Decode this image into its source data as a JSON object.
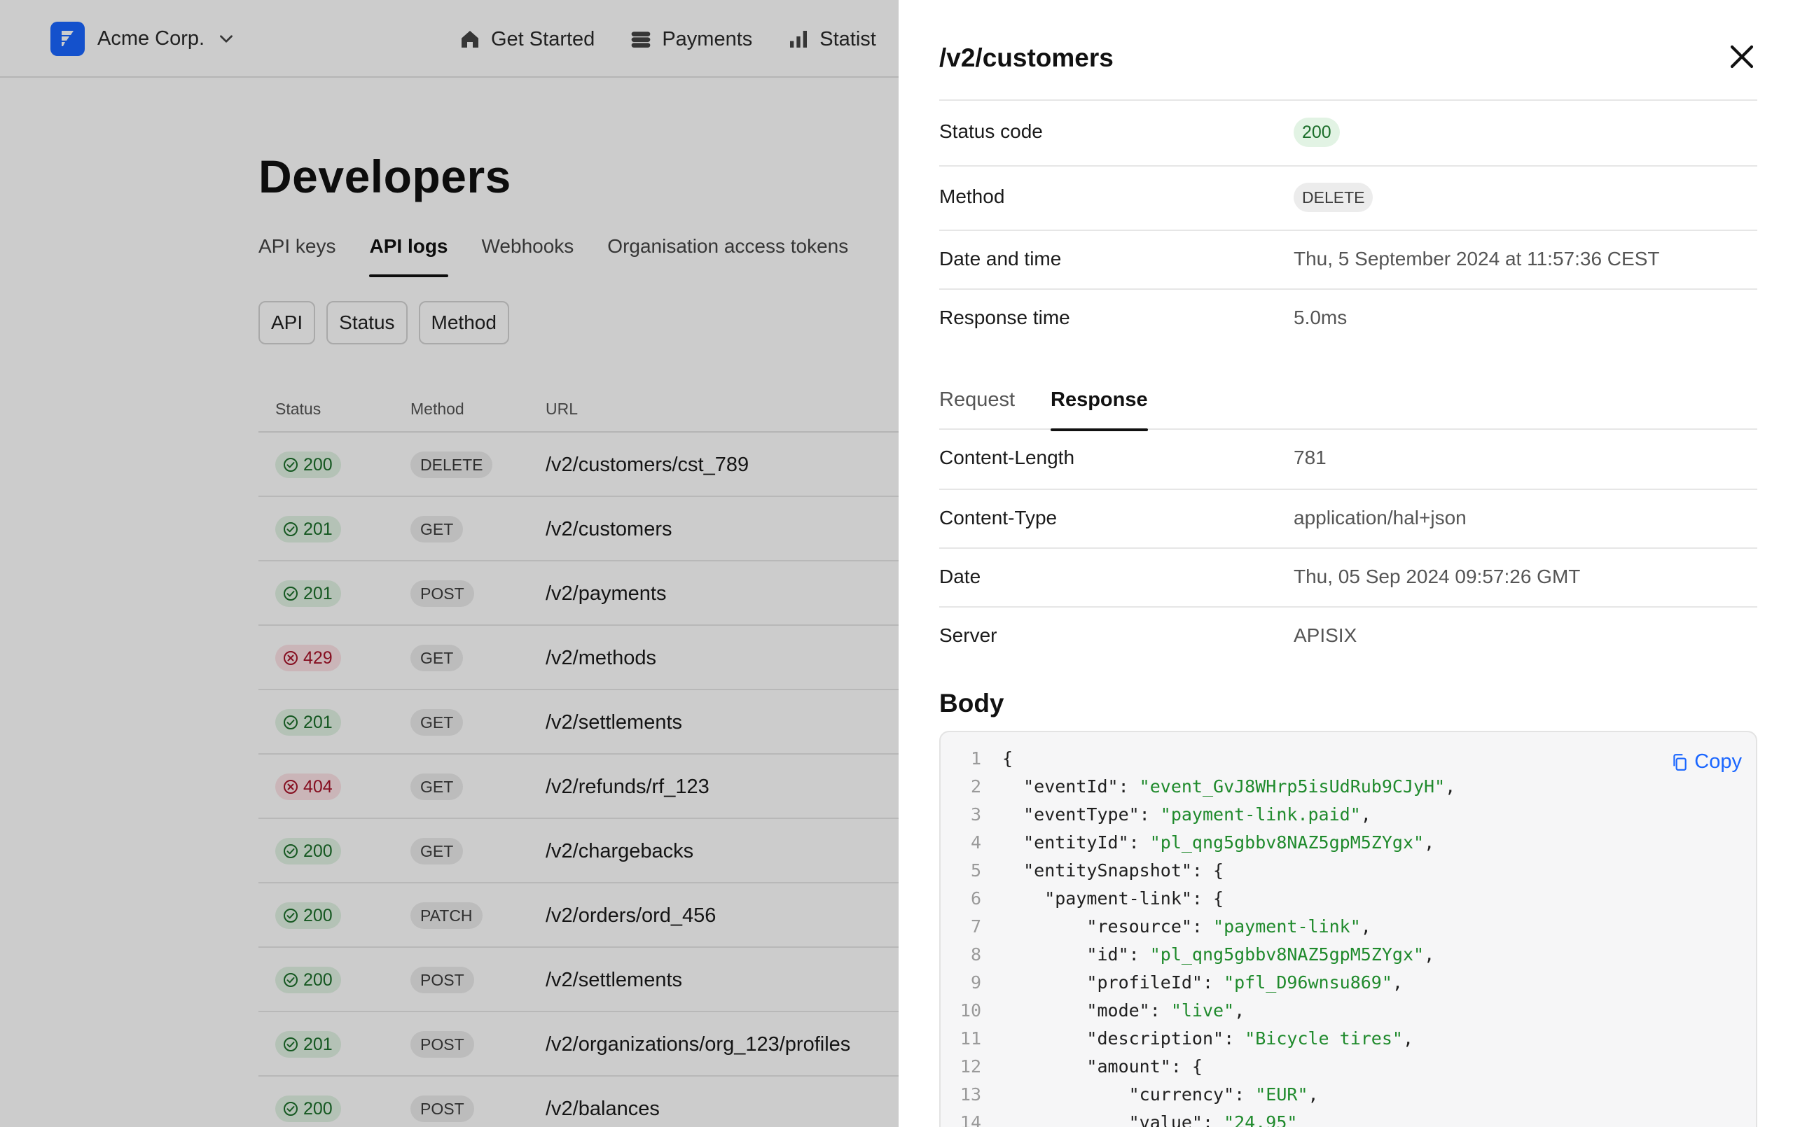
{
  "app": {
    "org_name": "Acme Corp.",
    "nav": [
      {
        "label": "Get Started",
        "icon": "home-icon"
      },
      {
        "label": "Payments",
        "icon": "payments-icon"
      },
      {
        "label": "Statist",
        "icon": "statistics-icon"
      }
    ],
    "page_title": "Developers",
    "tabs": [
      {
        "label": "API keys",
        "active": false
      },
      {
        "label": "API logs",
        "active": true
      },
      {
        "label": "Webhooks",
        "active": false
      },
      {
        "label": "Organisation access tokens",
        "active": false
      }
    ],
    "filters": [
      "API",
      "Status",
      "Method"
    ],
    "table": {
      "headers": {
        "status": "Status",
        "method": "Method",
        "url": "URL"
      },
      "rows": [
        {
          "status": "200",
          "ok": true,
          "method": "DELETE",
          "url": "/v2/customers/cst_789"
        },
        {
          "status": "201",
          "ok": true,
          "method": "GET",
          "url": "/v2/customers"
        },
        {
          "status": "201",
          "ok": true,
          "method": "POST",
          "url": "/v2/payments"
        },
        {
          "status": "429",
          "ok": false,
          "method": "GET",
          "url": "/v2/methods"
        },
        {
          "status": "201",
          "ok": true,
          "method": "GET",
          "url": "/v2/settlements"
        },
        {
          "status": "404",
          "ok": false,
          "method": "GET",
          "url": "/v2/refunds/rf_123"
        },
        {
          "status": "200",
          "ok": true,
          "method": "GET",
          "url": "/v2/chargebacks"
        },
        {
          "status": "200",
          "ok": true,
          "method": "PATCH",
          "url": "/v2/orders/ord_456"
        },
        {
          "status": "200",
          "ok": true,
          "method": "POST",
          "url": "/v2/settlements"
        },
        {
          "status": "201",
          "ok": true,
          "method": "POST",
          "url": "/v2/organizations/org_123/profiles"
        },
        {
          "status": "200",
          "ok": true,
          "method": "POST",
          "url": "/v2/balances"
        }
      ]
    }
  },
  "drawer": {
    "title": "/v2/customers",
    "status_code_label": "Status code",
    "status_code": "200",
    "method_label": "Method",
    "method": "DELETE",
    "datetime_label": "Date and time",
    "datetime": "Thu, 5 September 2024 at 11:57:36 CEST",
    "response_time_label": "Response time",
    "response_time": "5.0ms",
    "tabs": {
      "request": "Request",
      "response": "Response",
      "active": "response"
    },
    "headers": [
      {
        "key": "Content-Length",
        "value": "781"
      },
      {
        "key": "Content-Type",
        "value": "application/hal+json"
      },
      {
        "key": "Date",
        "value": "Thu, 05 Sep 2024 09:57:26 GMT"
      },
      {
        "key": "Server",
        "value": "APISIX"
      }
    ],
    "body_title": "Body",
    "copy_label": "Copy",
    "code_lines": [
      {
        "n": "1",
        "pre": "{",
        "str": "",
        "post": ""
      },
      {
        "n": "2",
        "pre": "  \"eventId\": ",
        "str": "\"event_GvJ8WHrp5isUdRub9CJyH\"",
        "post": ","
      },
      {
        "n": "3",
        "pre": "  \"eventType\": ",
        "str": "\"payment-link.paid\"",
        "post": ","
      },
      {
        "n": "4",
        "pre": "  \"entityId\": ",
        "str": "\"pl_qng5gbbv8NAZ5gpM5ZYgx\"",
        "post": ","
      },
      {
        "n": "5",
        "pre": "  \"entitySnapshot\": {",
        "str": "",
        "post": ""
      },
      {
        "n": "6",
        "pre": "    \"payment-link\": {",
        "str": "",
        "post": ""
      },
      {
        "n": "7",
        "pre": "        \"resource\": ",
        "str": "\"payment-link\"",
        "post": ","
      },
      {
        "n": "8",
        "pre": "        \"id\": ",
        "str": "\"pl_qng5gbbv8NAZ5gpM5ZYgx\"",
        "post": ","
      },
      {
        "n": "9",
        "pre": "        \"profileId\": ",
        "str": "\"pfl_D96wnsu869\"",
        "post": ","
      },
      {
        "n": "10",
        "pre": "        \"mode\": ",
        "str": "\"live\"",
        "post": ","
      },
      {
        "n": "11",
        "pre": "        \"description\": ",
        "str": "\"Bicycle tires\"",
        "post": ","
      },
      {
        "n": "12",
        "pre": "        \"amount\": {",
        "str": "",
        "post": ""
      },
      {
        "n": "13",
        "pre": "            \"currency\": ",
        "str": "\"EUR\"",
        "post": ","
      },
      {
        "n": "14",
        "pre": "            \"value\": ",
        "str": "\"24.95\"",
        "post": ""
      }
    ]
  },
  "colors": {
    "accent": "#1a66ff",
    "success_bg": "#e2f3e4",
    "success_fg": "#1b6e2a",
    "error_bg": "#fde3e6",
    "error_fg": "#a8132a",
    "code_string": "#1f8a2c"
  }
}
